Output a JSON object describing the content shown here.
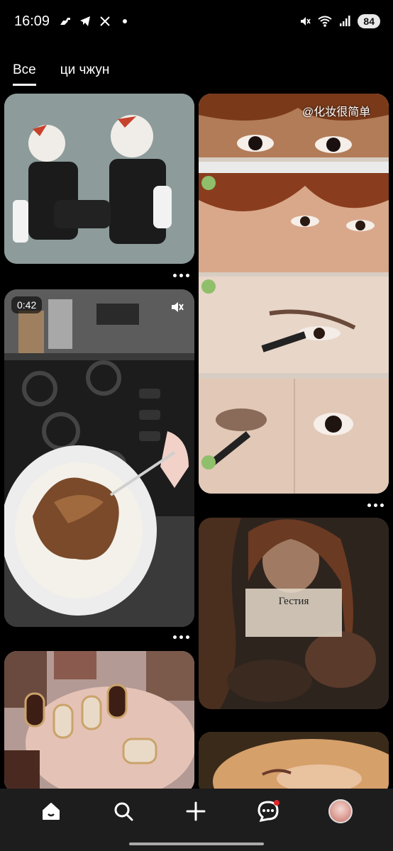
{
  "status_bar": {
    "time": "16:09",
    "left_icons": [
      "dino-icon",
      "telegram-icon",
      "x-icon",
      "dot-icon"
    ],
    "right_icons": [
      "mute-icon",
      "wifi-icon",
      "signal-icon"
    ],
    "battery": "84"
  },
  "tabs": [
    {
      "label": "Все",
      "active": true
    },
    {
      "label": "ци чжун",
      "active": false
    }
  ],
  "pins": {
    "video_duration": "0:42",
    "makeup_watermark": "@化妆很简单",
    "card_title": "Гестия"
  },
  "bottom_nav": {
    "items": [
      "home-icon",
      "search-icon",
      "create-icon",
      "messages-icon",
      "profile-avatar"
    ]
  }
}
